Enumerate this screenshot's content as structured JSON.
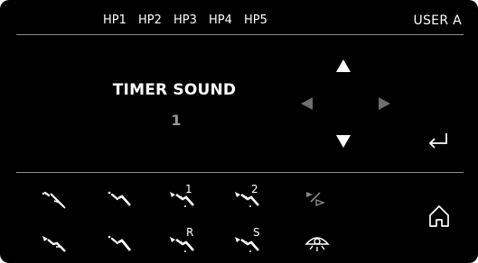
{
  "header": {
    "hp_tabs": [
      "HP1",
      "HP2",
      "HP3",
      "HP4",
      "HP5"
    ],
    "user": "USER A"
  },
  "main": {
    "title": "TIMER SOUND",
    "value": "1"
  },
  "nav": {
    "up_icon": "arrow-up",
    "down_icon": "arrow-down",
    "left_icon": "arrow-left-disabled",
    "right_icon": "arrow-right-disabled",
    "enter_icon": "enter-return-icon",
    "home_icon": "home-icon"
  },
  "tools": {
    "row1": [
      {
        "icon": "handpiece-scaler-icon"
      },
      {
        "icon": "handpiece-contra-icon"
      },
      {
        "icon": "handpiece-motor-icon",
        "label": "1"
      },
      {
        "icon": "handpiece-motor-icon",
        "label": "2"
      },
      {
        "icon": "handpiece-disabled-icon"
      }
    ],
    "row2": [
      {
        "icon": "handpiece-turbine-icon"
      },
      {
        "icon": "handpiece-straight-icon"
      },
      {
        "icon": "handpiece-motor-icon",
        "label": "R"
      },
      {
        "icon": "handpiece-motor-icon",
        "label": "S"
      },
      {
        "icon": "operating-light-icon"
      }
    ]
  },
  "colors": {
    "background": "#000000",
    "text": "#ffffff",
    "value_text": "#9a9a9a",
    "disabled": "#6e6e6e",
    "divider": "#8f8f8f"
  }
}
